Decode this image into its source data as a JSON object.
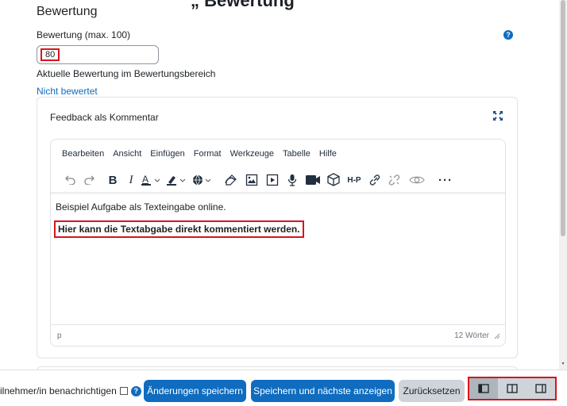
{
  "page": {
    "top_clipped_heading": "„ Bewertung",
    "section_title": "Bewertung"
  },
  "grade": {
    "label": "Bewertung (max. 100)",
    "value": "80",
    "current_grade_label": "Aktuelle Bewertung im Bewertungsbereich",
    "not_graded": "Nicht bewertet"
  },
  "feedback": {
    "title": "Feedback als Kommentar",
    "menubar": [
      "Bearbeiten",
      "Ansicht",
      "Einfügen",
      "Format",
      "Werkzeuge",
      "Tabelle",
      "Hilfe"
    ],
    "paragraph_1": "Beispiel Aufgabe als Texteingabe online.",
    "paragraph_2": "Hier kann die Textabgabe direkt kommentiert werden.",
    "status_path": "p",
    "word_count": "12 Wörter",
    "toolbar_h5p": "H-P"
  },
  "footer": {
    "notify_label": "ilnehmer/in benachrichtigen",
    "save_button": "Änderungen speichern",
    "save_next_button": "Speichern und nächste anzeigen",
    "reset_button": "Zurücksetzen"
  },
  "colors": {
    "primary": "#0f6cbf",
    "highlight": "#d9141e"
  }
}
